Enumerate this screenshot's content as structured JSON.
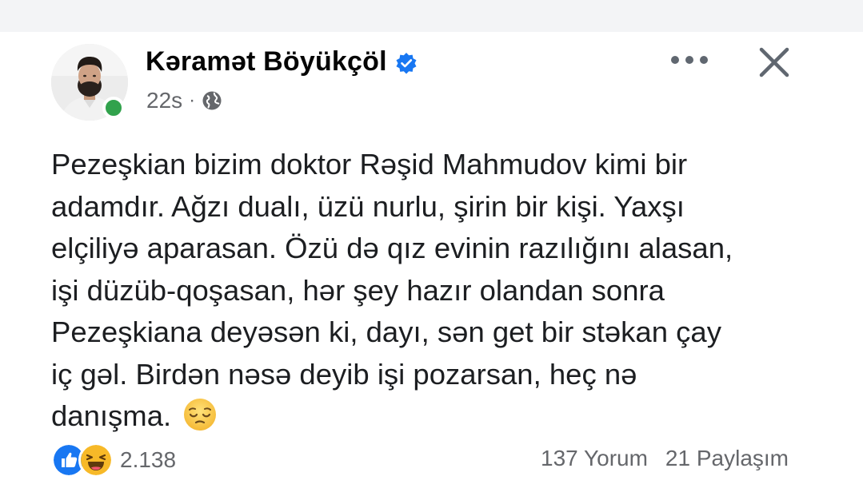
{
  "post": {
    "author": {
      "name": "Kəramət Böyükçöl",
      "verified_icon": "verified-badge-icon",
      "online_status_color": "#31a24c"
    },
    "timestamp": "22s",
    "separator": "·",
    "audience_icon": "globe-icon",
    "menu_icon": "more-options-icon",
    "close_icon": "close-icon",
    "text_lines": [
      "Pezeşkian bizim doktor Rəşid Mahmudov kimi bir",
      "adamdır. Ağzı dualı, üzü nurlu, şirin bir kişi. Yaxşı",
      "elçiliyə aparasan. Özü də qız evinin razılığını alasan,",
      "işi düzüb-qoşasan, hər şey hazır olandan sonra",
      "Pezeşkiana deyəsən ki, dayı, sən get bir stəkan çay",
      "iç gəl. Birdən nəsə deyib işi pozarsan, heç nə",
      "danışma."
    ],
    "text_emoji": "pensive-face-icon",
    "reactions": {
      "icons": [
        "like-icon",
        "haha-icon"
      ],
      "count": "2.138"
    },
    "comments": "137 Yorum",
    "shares": "21 Paylaşım"
  },
  "colors": {
    "text_primary": "#050505",
    "text_secondary": "#65676b",
    "verified_blue": "#1877f2",
    "like_blue": "#1877f2",
    "haha_yellow": "#f7b928"
  }
}
